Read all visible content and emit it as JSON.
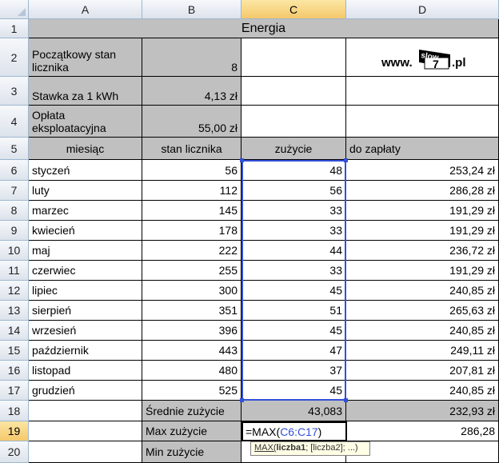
{
  "columns": [
    "A",
    "B",
    "C",
    "D"
  ],
  "rows": [
    "1",
    "2",
    "3",
    "4",
    "5",
    "6",
    "7",
    "8",
    "9",
    "10",
    "11",
    "12",
    "13",
    "14",
    "15",
    "16",
    "17",
    "18",
    "19",
    "20"
  ],
  "title": "Energia",
  "params": [
    {
      "label": "Początkowy stan licznika",
      "value": "8"
    },
    {
      "label": "Stawka za 1 kWh",
      "value": "4,13 zł"
    },
    {
      "label": "Opłata eksploatacyjna",
      "value": "55,00 zł"
    }
  ],
  "logo": {
    "prefix": "www.",
    "top": "slow",
    "num": "7",
    "suffix": ".pl"
  },
  "headers": {
    "month": "miesiąc",
    "reading": "stan licznika",
    "usage": "zużycie",
    "pay": "do zapłaty"
  },
  "months": [
    {
      "name": "styczeń",
      "reading": "56",
      "usage": "48",
      "pay": "253,24 zł"
    },
    {
      "name": "luty",
      "reading": "112",
      "usage": "56",
      "pay": "286,28 zł"
    },
    {
      "name": "marzec",
      "reading": "145",
      "usage": "33",
      "pay": "191,29 zł"
    },
    {
      "name": "kwiecień",
      "reading": "178",
      "usage": "33",
      "pay": "191,29 zł"
    },
    {
      "name": "maj",
      "reading": "222",
      "usage": "44",
      "pay": "236,72 zł"
    },
    {
      "name": "czerwiec",
      "reading": "255",
      "usage": "33",
      "pay": "191,29 zł"
    },
    {
      "name": "lipiec",
      "reading": "300",
      "usage": "45",
      "pay": "240,85 zł"
    },
    {
      "name": "sierpień",
      "reading": "351",
      "usage": "51",
      "pay": "265,63 zł"
    },
    {
      "name": "wrzesień",
      "reading": "396",
      "usage": "45",
      "pay": "240,85 zł"
    },
    {
      "name": "październik",
      "reading": "443",
      "usage": "47",
      "pay": "249,11 zł"
    },
    {
      "name": "listopad",
      "reading": "480",
      "usage": "37",
      "pay": "207,81 zł"
    },
    {
      "name": "grudzień",
      "reading": "525",
      "usage": "45",
      "pay": "240,85 zł"
    }
  ],
  "summary": {
    "avg_label": "Średnie zużycie",
    "avg_usage": "43,083",
    "avg_pay": "232,93 zł",
    "max_label": "Max zużycie",
    "formula_prefix": "=MAX(",
    "formula_ref": "C6:C17",
    "formula_suffix": ")",
    "max_pay": "286,28",
    "min_label": "Min zużycie"
  },
  "tooltip": {
    "fn": "MAX(",
    "arg1": "liczba1",
    "rest": "; [liczba2]; ...)"
  }
}
